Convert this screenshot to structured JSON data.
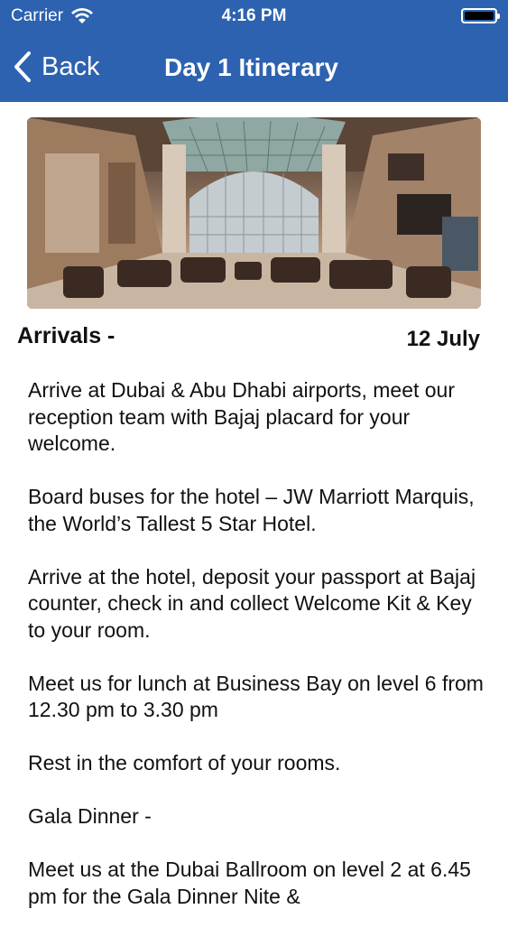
{
  "status_bar": {
    "carrier": "Carrier",
    "time": "4:16 PM"
  },
  "nav": {
    "back_label": "Back",
    "title": "Day 1 Itinerary"
  },
  "section": {
    "title": "Arrivals -",
    "date": "12 July"
  },
  "paragraphs": [
    "Arrive at Dubai & Abu Dhabi airports, meet our reception team with Bajaj placard for your welcome.",
    "Board buses for the hotel – JW Marriott Marquis, the World’s Tallest 5 Star Hotel.",
    "Arrive at the hotel, deposit your passport at Bajaj counter, check in and collect Welcome Kit & Key to your room.",
    "Meet us for lunch at Business Bay on level 6 from 12.30 pm to 3.30 pm",
    "Rest in the comfort of your rooms.",
    "Gala Dinner -",
    "Meet us at the Dubai Ballroom on level 2 at 6.45 pm for the Gala Dinner Nite &"
  ],
  "colors": {
    "nav_background": "#2d62b0",
    "nav_text": "#ffffff"
  },
  "icons": {
    "back": "chevron-left-icon",
    "wifi": "wifi-icon",
    "battery": "battery-icon"
  }
}
